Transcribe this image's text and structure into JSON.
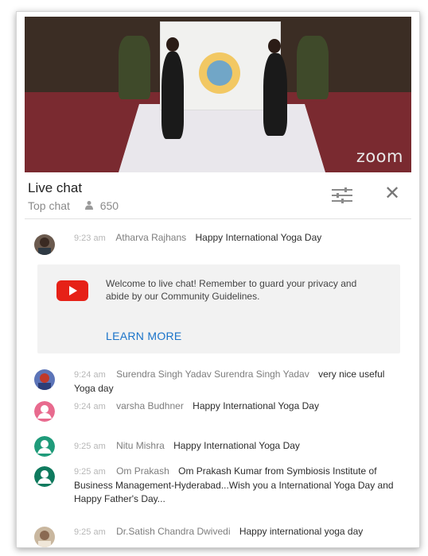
{
  "video": {
    "watermark": "zoom"
  },
  "chat": {
    "title": "Live chat",
    "mode": "Top chat",
    "viewer_count": "650",
    "icons": {
      "viewers": "person-icon",
      "filter": "sliders-icon",
      "close": "close-icon"
    }
  },
  "welcome": {
    "message": "Welcome to live chat! Remember to guard your privacy and abide by our Community Guidelines.",
    "learn_more": "LEARN MORE",
    "brand_color": "#e62117",
    "link_color": "#1a73c9"
  },
  "messages": [
    {
      "time": "9:23 am",
      "author": "Atharva Rajhans",
      "text": "Happy International Yoga Day",
      "avatar": "photo"
    },
    {
      "time": "9:24 am",
      "author": "Surendra Singh Yadav Surendra Singh Yadav",
      "text": "very nice useful Yoga day",
      "avatar": "photo"
    },
    {
      "time": "9:24 am",
      "author": "varsha Budhner",
      "text": "Happy International Yoga Day",
      "avatar": "default",
      "avatar_color": "#e86a8e"
    },
    {
      "time": "9:25 am",
      "author": "Nitu Mishra",
      "text": "Happy International Yoga Day",
      "avatar": "default",
      "avatar_color": "#1f9b7a"
    },
    {
      "time": "9:25 am",
      "author": "Om Prakash",
      "text": "Om Prakash Kumar from Symbiosis Institute of Business Management-Hyderabad...Wish you a International Yoga Day and Happy Father's Day...",
      "avatar": "default",
      "avatar_color": "#0f7a5e"
    },
    {
      "time": "9:25 am",
      "author": "Dr.Satish Chandra Dwivedi",
      "text": "Happy international yoga day",
      "avatar": "photo"
    }
  ]
}
